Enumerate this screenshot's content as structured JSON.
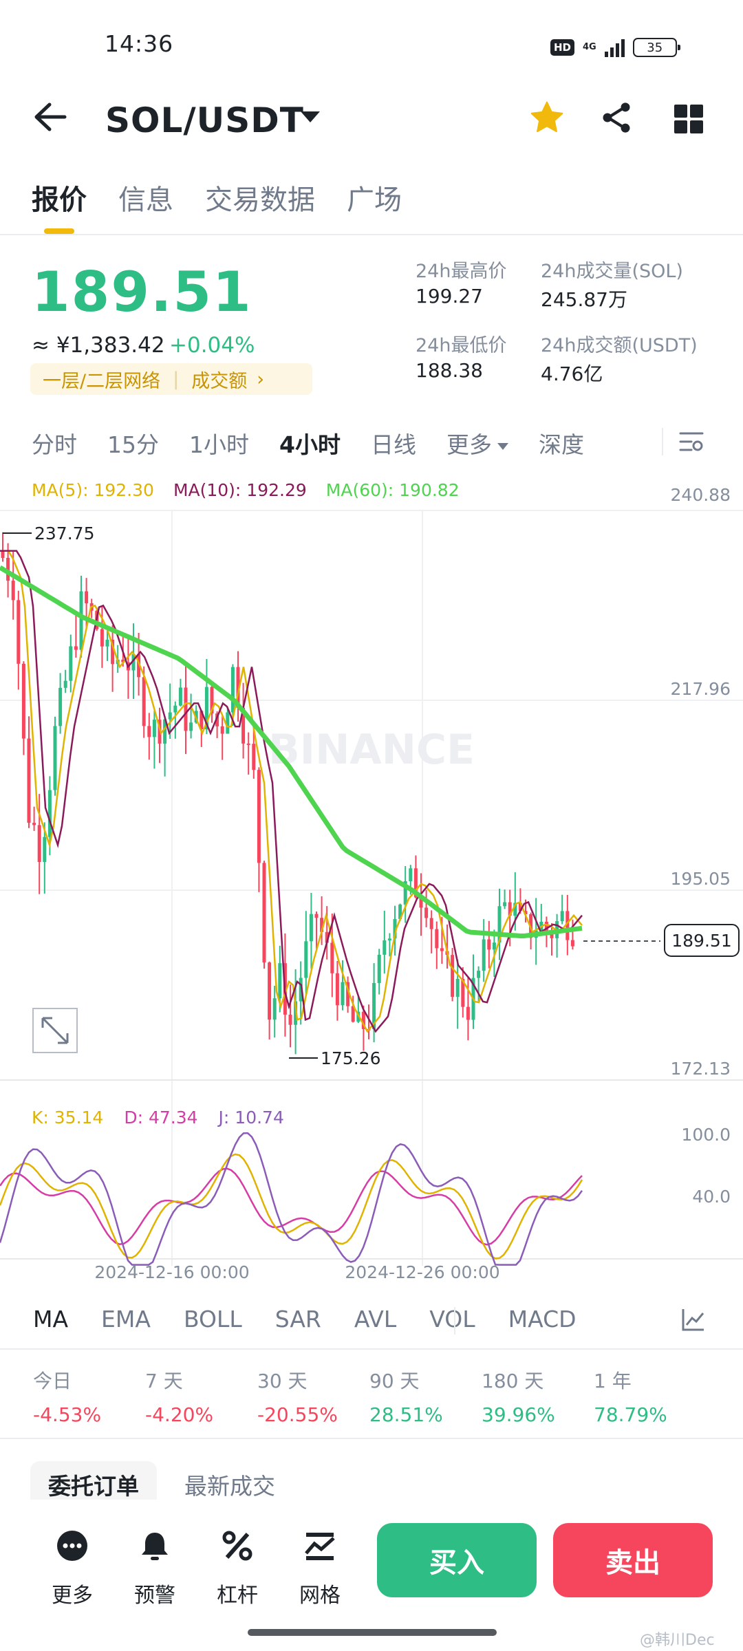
{
  "status_bar": {
    "time": "14:36",
    "hd": "HD",
    "network": "4G",
    "battery": "35"
  },
  "header": {
    "pair": "SOL/USDT"
  },
  "tabs": [
    {
      "label": "报价",
      "active": true
    },
    {
      "label": "信息",
      "active": false
    },
    {
      "label": "交易数据",
      "active": false
    },
    {
      "label": "广场",
      "active": false
    }
  ],
  "price": {
    "last": "189.51",
    "cny": "≈ ¥1,383.42",
    "change": "+0.04%",
    "tag_network": "一层/二层网络",
    "tag_rank": "成交额",
    "tag_arrow": "›"
  },
  "stats": {
    "high_label": "24h最高价",
    "high_value": "199.27",
    "low_label": "24h最低价",
    "low_value": "188.38",
    "vol_label": "24h成交量(SOL)",
    "vol_value": "245.87万",
    "amt_label": "24h成交额(USDT)",
    "amt_value": "4.76亿"
  },
  "intervals": [
    "分时",
    "15分",
    "1小时",
    "4小时",
    "日线",
    "更多",
    "深度"
  ],
  "active_interval": "4小时",
  "ma_legend": {
    "ma5": "MA(5): 192.30",
    "ma10": "MA(10): 192.29",
    "ma60": "MA(60): 190.82"
  },
  "kdj_legend": {
    "k": "K: 35.14",
    "d": "D: 47.34",
    "j": "J: 10.74"
  },
  "chart_data": [
    {
      "type": "candlestick",
      "title": "",
      "watermark": "BINANCE",
      "y_ticks": [
        "240.88",
        "217.96",
        "195.05",
        "172.13"
      ],
      "ylim": [
        172.13,
        240.88
      ],
      "current_price_label": "189.51",
      "annotations": [
        {
          "label": "237.75"
        },
        {
          "label": "175.26"
        }
      ],
      "x_ticks": [
        "2024-12-16 00:00",
        "2024-12-26 00:00"
      ],
      "ma5_color": "#e0b300",
      "ma10_color": "#8b1a5a",
      "ma60_color": "#4fd44f"
    },
    {
      "type": "line",
      "title": "KDJ",
      "y_ticks": [
        "100.0",
        "40.0"
      ],
      "k_color": "#e0b300",
      "d_color": "#d63ca5",
      "j_color": "#8a5cb8"
    }
  ],
  "indicator_tabs": [
    "MA",
    "EMA",
    "BOLL",
    "SAR",
    "AVL",
    "VOL",
    "MACD"
  ],
  "performance": [
    {
      "label": "今日",
      "value": "-4.53%",
      "trend": "neg"
    },
    {
      "label": "7 天",
      "value": "-4.20%",
      "trend": "neg"
    },
    {
      "label": "30 天",
      "value": "-20.55%",
      "trend": "neg"
    },
    {
      "label": "90 天",
      "value": "28.51%",
      "trend": "pos"
    },
    {
      "label": "180 天",
      "value": "39.96%",
      "trend": "pos"
    },
    {
      "label": "1 年",
      "value": "78.79%",
      "trend": "pos"
    }
  ],
  "order_tabs": [
    "委托订单",
    "最新成交"
  ],
  "bottom_nav": [
    {
      "label": "更多",
      "icon": "more-icon"
    },
    {
      "label": "预警",
      "icon": "bell-icon"
    },
    {
      "label": "杠杆",
      "icon": "leverage-icon"
    },
    {
      "label": "网格",
      "icon": "grid-trading-icon"
    }
  ],
  "actions": {
    "buy": "买入",
    "sell": "卖出"
  },
  "corner_watermark": "@韩川Dec"
}
